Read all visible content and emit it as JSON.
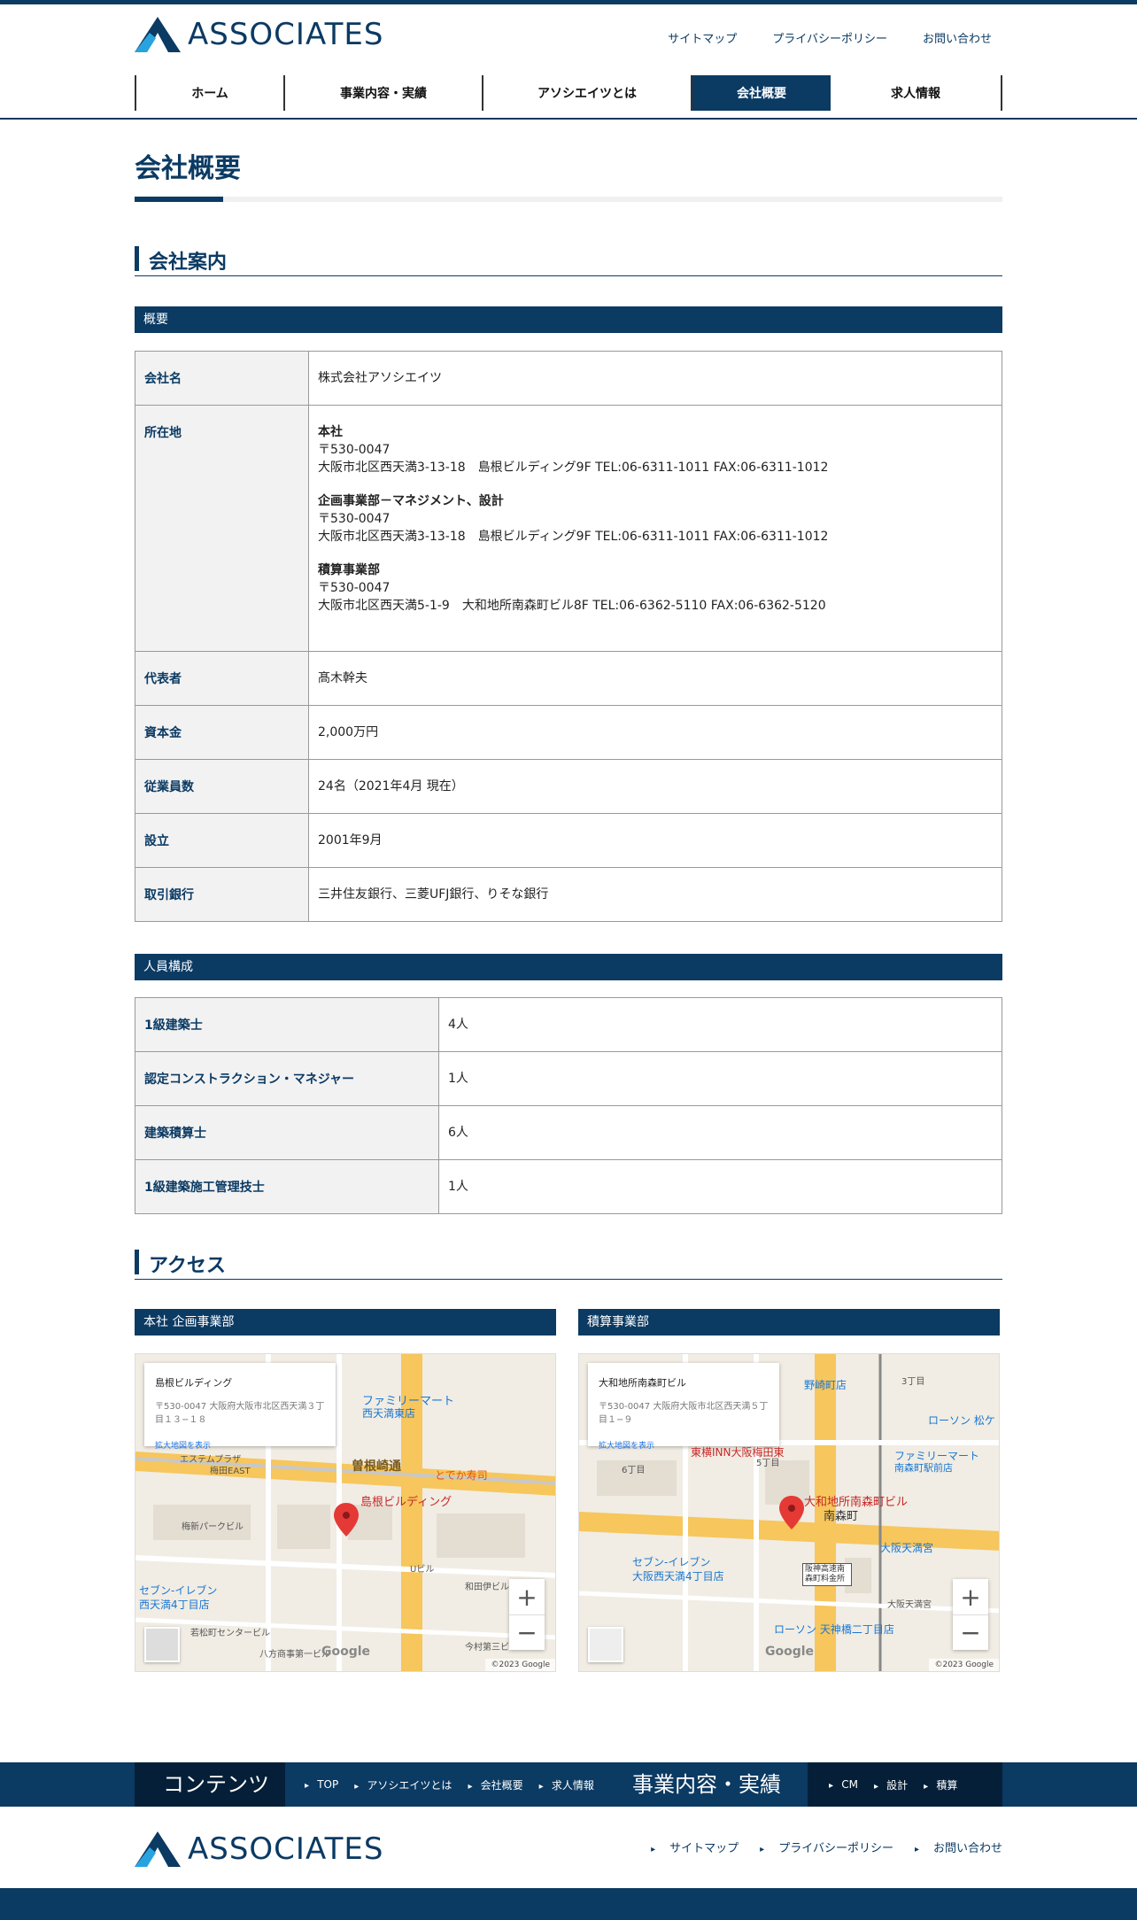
{
  "brand": {
    "name": "ASSOCIATES",
    "color": "#0b3a63",
    "accent": "#29a3e0"
  },
  "util_links": [
    "サイトマップ",
    "プライバシーポリシー",
    "お問い合わせ"
  ],
  "nav": [
    {
      "label": "ホーム",
      "active": false
    },
    {
      "label": "事業内容・実績",
      "active": false
    },
    {
      "label": "アソシエイツとは",
      "active": false
    },
    {
      "label": "会社概要",
      "active": true
    },
    {
      "label": "求人情報",
      "active": false
    }
  ],
  "page_title": "会社概要",
  "company_section": {
    "heading": "会社案内",
    "overview_band": "概要",
    "rows": {
      "name": {
        "label": "会社名",
        "value": "株式会社アソシエイツ"
      },
      "location": {
        "label": "所在地",
        "offices": [
          {
            "name": "本社",
            "zip": "〒530-0047",
            "address": "大阪市北区西天満3-13-18　島根ビルディング9F TEL:06-6311-1011 FAX:06-6311-1012"
          },
          {
            "name": "企画事業部－マネジメント、設計",
            "zip": "〒530-0047",
            "address": "大阪市北区西天満3-13-18　島根ビルディング9F TEL:06-6311-1011 FAX:06-6311-1012"
          },
          {
            "name": "積算事業部",
            "zip": "〒530-0047",
            "address": "大阪市北区西天満5-1-9　大和地所南森町ビル8F TEL:06-6362-5110 FAX:06-6362-5120"
          }
        ]
      },
      "rep": {
        "label": "代表者",
        "value": "髙木幹夫"
      },
      "capital": {
        "label": "資本金",
        "value": "2,000万円"
      },
      "employees": {
        "label": "従業員数",
        "value": "24名（2021年4月 現在）"
      },
      "founded": {
        "label": "設立",
        "value": "2001年9月"
      },
      "banks": {
        "label": "取引銀行",
        "value": "三井住友銀行、三菱UFJ銀行、りそな銀行"
      }
    },
    "staff_band": "人員構成",
    "staff": [
      {
        "label": "1級建築士",
        "value": "4人"
      },
      {
        "label": "認定コンストラクション・マネジャー",
        "value": "1人"
      },
      {
        "label": "建築積算士",
        "value": "6人"
      },
      {
        "label": "1級建築施工管理技士",
        "value": "1人"
      }
    ]
  },
  "access": {
    "heading": "アクセス",
    "maps": [
      {
        "band": "本社 企画事業部",
        "pin_label": "島根ビルディング",
        "card_title": "島根ビルディング",
        "card_zip": "〒530-0047 大阪府大阪市北区西天満３丁目１３−１８",
        "card_link": "拡大地図を表示",
        "street": "曽根崎通",
        "labels": [
          "ファミリーマート",
          "西天満東店",
          "とでか寿司",
          "エステムプラザ",
          "梅田EAST",
          "梅新パークビル",
          "若松町センタービル",
          "八方商事第一ビル",
          "今村第三ビル",
          "和田伊ビル",
          "セブン-イレブン",
          "西天満4丁目店",
          "Uビル"
        ],
        "copyright": "©2023 Google"
      },
      {
        "band": "積算事業部",
        "pin_label": "大和地所南森町ビル",
        "card_title": "大和地所南森町ビル",
        "card_zip": "〒530-0047 大阪府大阪市北区西天満５丁目１−９",
        "card_link": "拡大地図を表示",
        "street": "南森町",
        "labels": [
          "野崎町店",
          "ローソン 松ケ",
          "東横INN大阪梅田東",
          "ファミリーマート",
          "南森町駅前店",
          "大阪天満宮",
          "セブン-イレブン",
          "大阪西天満4丁目店",
          "阪神高速南森町料金所",
          "ローソン 天神橋二丁目店",
          "大阪天満宮",
          "3丁目",
          "5丁目",
          "6丁目"
        ],
        "copyright": "©2023 Google"
      }
    ],
    "zoom_plus": "+",
    "zoom_minus": "−",
    "google": "Google"
  },
  "footer": {
    "contents_head": "コンテンツ",
    "contents_links": [
      "TOP",
      "アソシエイツとは",
      "会社概要",
      "求人情報"
    ],
    "business_head": "事業内容・実績",
    "business_links": [
      "CM",
      "設計",
      "積算"
    ],
    "links": [
      "サイトマップ",
      "プライバシーポリシー",
      "お問い合わせ"
    ]
  }
}
